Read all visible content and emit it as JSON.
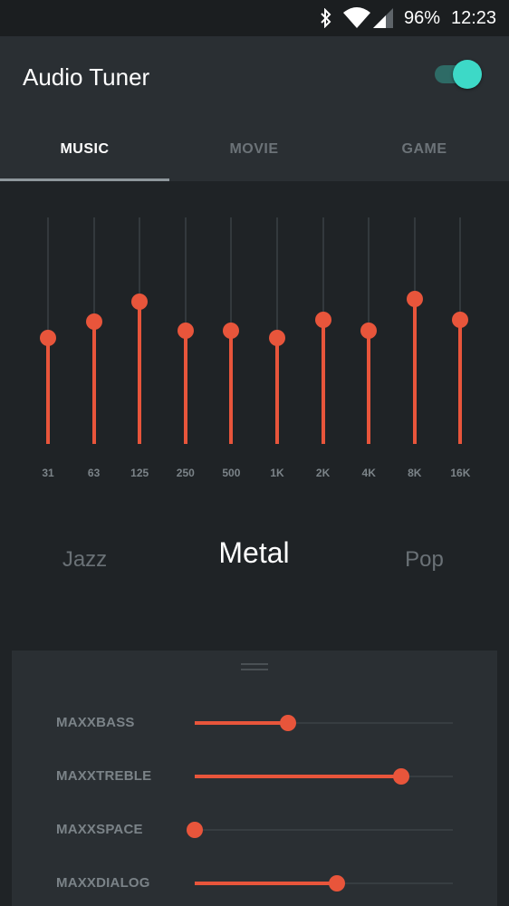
{
  "status_bar": {
    "battery": "96%",
    "time": "12:23",
    "icons": [
      "bluetooth-icon",
      "wifi-icon",
      "cell-signal-icon"
    ]
  },
  "app": {
    "title": "Audio Tuner",
    "enabled": true
  },
  "tabs": [
    {
      "label": "MUSIC",
      "active": true
    },
    {
      "label": "MOVIE",
      "active": false
    },
    {
      "label": "GAME",
      "active": false
    }
  ],
  "equalizer": {
    "bands": [
      {
        "label": "31",
        "level": 0.47
      },
      {
        "label": "63",
        "level": 0.54
      },
      {
        "label": "125",
        "level": 0.63
      },
      {
        "label": "250",
        "level": 0.5
      },
      {
        "label": "500",
        "level": 0.5
      },
      {
        "label": "1K",
        "level": 0.47
      },
      {
        "label": "2K",
        "level": 0.55
      },
      {
        "label": "4K",
        "level": 0.5
      },
      {
        "label": "8K",
        "level": 0.64
      },
      {
        "label": "16K",
        "level": 0.55
      }
    ]
  },
  "presets": {
    "previous": "Jazz",
    "current": "Metal",
    "next": "Pop"
  },
  "effects": [
    {
      "label": "MAXXBASS",
      "level": 0.36
    },
    {
      "label": "MAXXTREBLE",
      "level": 0.8
    },
    {
      "label": "MAXXSPACE",
      "level": 0.0
    },
    {
      "label": "MAXXDIALOG",
      "level": 0.55
    }
  ],
  "colors": {
    "accent": "#e8553b",
    "toggle_on": "#3dd9c7",
    "background": "#1f2326",
    "surface": "#2a2f33"
  }
}
